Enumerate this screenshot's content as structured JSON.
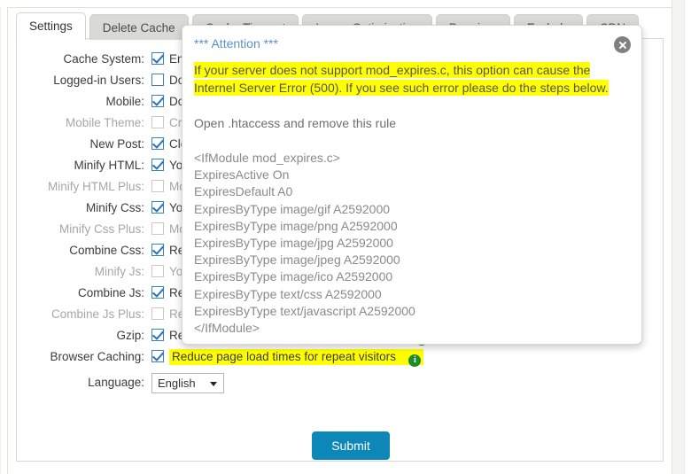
{
  "tabs": [
    {
      "label": "Settings",
      "active": true
    },
    {
      "label": "Delete Cache",
      "active": false
    },
    {
      "label": "Cache Timeout",
      "active": false
    },
    {
      "label": "Image Optimization",
      "active": false
    },
    {
      "label": "Premium",
      "active": false
    },
    {
      "label": "Exclude",
      "active": false
    },
    {
      "label": "CDN",
      "active": false
    }
  ],
  "settings": {
    "rows": [
      {
        "label": "Cache System:",
        "checked": true,
        "disabled": false,
        "text": "Enable",
        "highlight": false,
        "info": false
      },
      {
        "label": "Logged-in Users:",
        "checked": false,
        "disabled": false,
        "text": "Do",
        "highlight": false,
        "info": false
      },
      {
        "label": "Mobile:",
        "checked": true,
        "disabled": false,
        "text": "Do",
        "highlight": false,
        "info": false
      },
      {
        "label": "Mobile Theme:",
        "checked": false,
        "disabled": true,
        "text": "Cre",
        "highlight": false,
        "info": false
      },
      {
        "label": "New Post:",
        "checked": true,
        "disabled": false,
        "text": "Clea",
        "highlight": false,
        "info": false
      },
      {
        "label": "Minify HTML:",
        "checked": true,
        "disabled": false,
        "text": "You",
        "highlight": false,
        "info": false
      },
      {
        "label": "Minify HTML Plus:",
        "checked": false,
        "disabled": true,
        "text": "Mo",
        "highlight": false,
        "info": false
      },
      {
        "label": "Minify Css:",
        "checked": true,
        "disabled": false,
        "text": "You",
        "highlight": false,
        "info": false
      },
      {
        "label": "Minify Css Plus:",
        "checked": false,
        "disabled": true,
        "text": "Mo",
        "highlight": false,
        "info": false
      },
      {
        "label": "Combine Css:",
        "checked": true,
        "disabled": false,
        "text": "Red",
        "highlight": false,
        "info": false
      },
      {
        "label": "Minify Js:",
        "checked": false,
        "disabled": true,
        "text": "You",
        "highlight": false,
        "info": false
      },
      {
        "label": "Combine Js:",
        "checked": true,
        "disabled": false,
        "text": "Red",
        "highlight": false,
        "info": false
      },
      {
        "label": "Combine Js Plus:",
        "checked": false,
        "disabled": true,
        "text": "Red",
        "highlight": false,
        "info": false
      },
      {
        "label": "Gzip:",
        "checked": true,
        "disabled": false,
        "text": "Reduce the size of files sent from your server",
        "highlight": false,
        "info": true
      },
      {
        "label": "Browser Caching:",
        "checked": true,
        "disabled": false,
        "text": "Reduce page load times for repeat visitors",
        "highlight": true,
        "info": true
      }
    ],
    "language_label": "Language:",
    "language_value": "English"
  },
  "submit": {
    "label": "Submit"
  },
  "dialog": {
    "title": "*** Attention ***",
    "close_icon": "close-icon",
    "warning_lines": [
      "If your server does not support mod_expires.c, this option can cause the",
      "Internel Server Error (500). If you see such error please do the steps below."
    ],
    "instruction": "Open .htaccess and remove this rule",
    "rule_lines": [
      "<IfModule mod_expires.c>",
      "ExpiresActive On",
      "ExpiresDefault A0",
      "ExpiresByType image/gif A2592000",
      "ExpiresByType image/png A2592000",
      "ExpiresByType image/jpg A2592000",
      "ExpiresByType image/jpeg A2592000",
      "ExpiresByType image/ico A2592000",
      "ExpiresByType text/css A2592000",
      "ExpiresByType text/javascript A2592000",
      "</IfModule>"
    ]
  },
  "colors": {
    "accent_blue": "#0d87b8",
    "title_blue": "#5b91c9",
    "highlight_yellow": "#ffff00",
    "info_green": "#1c8c2d"
  }
}
